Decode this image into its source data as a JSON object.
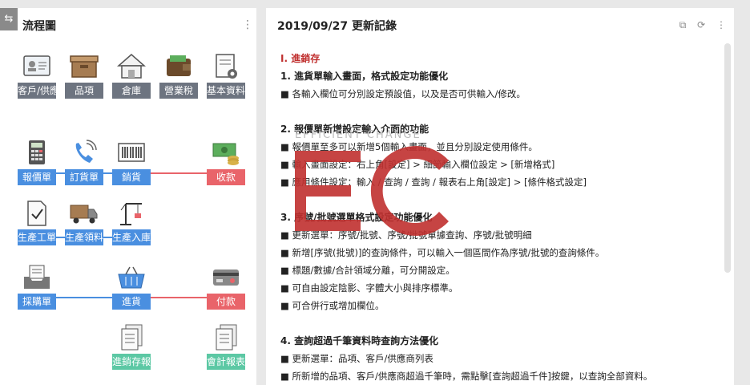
{
  "left": {
    "toggle_icon": "⇆",
    "title": "流程圖",
    "nodes": {
      "customer": "客戶/供應",
      "item": "品項",
      "warehouse": "倉庫",
      "tax": "營業稅",
      "basic": "基本資料",
      "quote": "報價單",
      "order": "訂貨單",
      "sales": "銷貨",
      "receipt": "收款",
      "work_order": "生產工單",
      "material": "生產領料",
      "production_in": "生產入庫",
      "purchase_order": "採購單",
      "purchase": "進貨",
      "payment": "付款",
      "inventory_report": "進銷存報",
      "accounting_report": "會計報表"
    }
  },
  "right": {
    "title": "2019/09/27 更新記錄",
    "section": "Ⅰ. 進銷存",
    "blocks": [
      {
        "heading": "1. 進貨單輸入畫面，格式設定功能優化",
        "items": [
          "■ 各輸入欄位可分別設定預設值，以及是否可供輸入/修改。"
        ]
      },
      {
        "heading": "2. 報價單新增設定輸入介面的功能",
        "items": [
          "■ 報價單至多可以新增5個輸入畫面，並且分別設定使用條件。",
          "■ 輸入畫面設定：右上角[設定] > 細節輸入欄位設定 > [新增格式]",
          "■ 應用條件設定：輸入 / 查詢 / 查詢 / 報表右上角[設定] > [條件格式設定]"
        ]
      },
      {
        "heading": "3. 序號/批號選單格式設定功能優化",
        "items": [
          "■ 更新選單：序號/批號、序號/批號單據查詢、序號/批號明細",
          "■ 新增[序號(批號)]的查詢條件，可以輸入一個區間作為序號/批號的查詢條件。",
          "■ 標題/數據/合計領域分離，可分開設定。",
          "■ 可自由設定陰影、字體大小與排序標準。",
          "■ 可合併行或增加欄位。"
        ]
      },
      {
        "heading": "4. 查詢超過千筆資料時查詢方法優化",
        "items": [
          "■ 更新選單：品項、客戶/供應商列表",
          "■ 所新增的品項、客戶/供應商超過千筆時，需點擊[查詢超過千件]按鍵，以查詢全部資料。"
        ]
      }
    ]
  },
  "watermark": {
    "text": "EFFICIENT CHANGE",
    "letters": "EC",
    "color": "#c0302f"
  },
  "colors": {
    "blue": "#4a8fe0",
    "red": "#e9646a",
    "green": "#5cc8a4",
    "gray": "#6d7480"
  }
}
